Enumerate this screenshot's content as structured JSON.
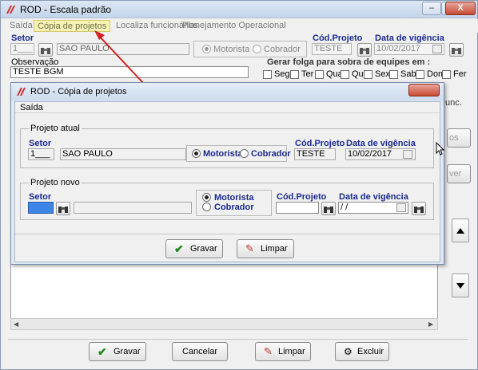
{
  "window": {
    "title": "ROD - Escala padrão",
    "controls": {
      "minimize": "–",
      "maximize": "□",
      "close": "X"
    }
  },
  "menu": {
    "items": [
      "Saída",
      "Cópia de projetos",
      "Localiza funcionários",
      "Planejamento Operacional"
    ]
  },
  "main_form": {
    "setor_label": "Setor",
    "setor_code": "1___",
    "setor_name": "SAO PAULO",
    "motorista_label": "Motorista",
    "cobrador_label": "Cobrador",
    "cod_projeto_label": "Cód.Projeto",
    "cod_projeto_value": "TESTE",
    "data_vigencia_label": "Data de vigência",
    "data_vigencia_value": "10/02/2017",
    "observacao_label": "Observação",
    "observacao_value": "TESTE BGM",
    "folga_title": "Gerar folga para sobra de equipes em :",
    "days": [
      "Seg",
      "Ter",
      "Qua",
      "Qui",
      "Sex",
      "Sab",
      "Dom",
      "Fer"
    ],
    "partial_right": [
      "os",
      "ver",
      "unc."
    ]
  },
  "bottom_buttons": {
    "gravar": "Gravar",
    "cancelar": "Cancelar",
    "limpar": "Limpar",
    "excluir": "Excluir"
  },
  "dialog": {
    "title": "ROD - Cópia de projetos",
    "menu_saida": "Saída",
    "atual": {
      "group_title": "Projeto atual",
      "setor_label": "Setor",
      "setor_code": "1___",
      "setor_name": "SAO PAULO",
      "motorista_label": "Motorista",
      "cobrador_label": "Cobrador",
      "cod_label": "Cód.Projeto",
      "cod_value": "TESTE",
      "data_label": "Data de vigência",
      "data_value": "10/02/2017"
    },
    "novo": {
      "group_title": "Projeto novo",
      "setor_label": "Setor",
      "motorista_label": "Motorista",
      "cobrador_label": "Cobrador",
      "cod_label": "Cód.Projeto",
      "data_label": "Data de vigência",
      "data_value": " / /"
    },
    "buttons": {
      "gravar": "Gravar",
      "limpar": "Limpar"
    }
  },
  "colors": {
    "accent_label": "#1a2a8c",
    "arrow": "#d42020",
    "menu_highlight": "#f6f3b4"
  }
}
